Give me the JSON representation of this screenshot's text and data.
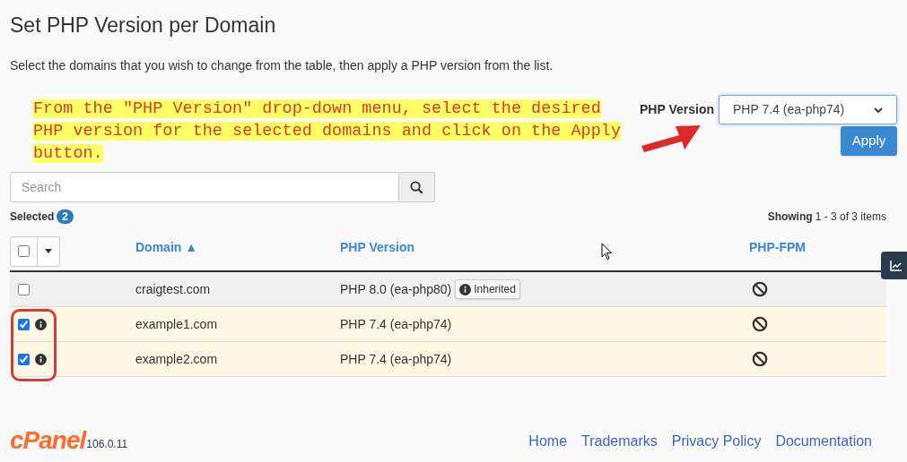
{
  "title": "Set PHP Version per Domain",
  "description": "Select the domains that you wish to change from the table, then apply a PHP version from the list.",
  "annotation": "From the \"PHP Version\" drop-down menu, select the desired PHP version for the selected domains and click on the Apply button.",
  "php_version": {
    "label": "PHP Version",
    "value": "PHP 7.4 (ea-php74)",
    "apply": "Apply"
  },
  "search": {
    "placeholder": "Search"
  },
  "selected": {
    "label": "Selected",
    "count": "2"
  },
  "showing": {
    "prefix": "Showing",
    "range": "1 - 3 of 3 items"
  },
  "table": {
    "select_all": {
      "checked": false
    },
    "columns": [
      {
        "label": "Domain",
        "sort": "▲"
      },
      {
        "label": "PHP Version"
      },
      {
        "label": "PHP-FPM"
      }
    ],
    "rows": [
      {
        "selected": false,
        "domain": "craigtest.com",
        "version": "PHP 8.0 (ea-php80)",
        "badge": "Inherited"
      },
      {
        "selected": true,
        "domain": "example1.com",
        "version": "PHP 7.4 (ea-php74)"
      },
      {
        "selected": true,
        "domain": "example2.com",
        "version": "PHP 7.4 (ea-php74)"
      }
    ]
  },
  "footer": {
    "logo": "cPanel",
    "version": "106.0.11",
    "links": [
      "Home",
      "Trademarks",
      "Privacy Policy",
      "Documentation"
    ]
  }
}
